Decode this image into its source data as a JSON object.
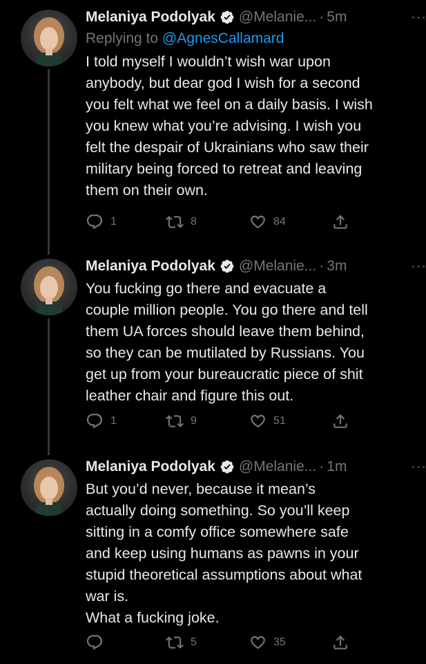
{
  "colors": {
    "background": "#000000",
    "text": "#e7e9ea",
    "muted": "#71767b",
    "link": "#1d9bf0",
    "verified": "#e7e9ea"
  },
  "tweets": [
    {
      "name": "Melaniya Podolyak",
      "handle": "@Melanie...",
      "time": "5m",
      "replying_prefix": "Replying to ",
      "replying_to": "@AgnesCallamard",
      "text": "I told myself I wouldn’t wish war upon\nanybody, but dear god I wish for a second\nyou felt what we feel on a daily basis. I wish\nyou knew what you’re advising. I wish you\nfelt the despair of Ukrainians who saw their\nmilitary being forced to retreat and leaving\nthem on their own.",
      "replies": "1",
      "retweets": "8",
      "likes": "84",
      "icons": [
        "reply-icon",
        "retweet-icon",
        "like-icon",
        "share-icon"
      ]
    },
    {
      "name": "Melaniya Podolyak",
      "handle": "@Melanie...",
      "time": "3m",
      "text": "You fucking go there and evacuate a\ncouple million people. You go there and tell\nthem UA forces should leave them behind,\nso they can be mutilated by Russians. You\nget up from your bureaucratic piece of shit\nleather chair and figure this out.",
      "replies": "1",
      "retweets": "9",
      "likes": "51",
      "icons": [
        "reply-icon",
        "retweet-icon",
        "like-icon",
        "share-icon"
      ]
    },
    {
      "name": "Melaniya Podolyak",
      "handle": "@Melanie...",
      "time": "1m",
      "text": "But you’d never, because it mean’s\nactually doing something. So you’ll keep\nsitting in a comfy office somewhere safe\nand keep using humans as pawns in your\nstupid theoretical assumptions about what\nwar is.\nWhat a fucking joke.",
      "replies": "",
      "retweets": "5",
      "likes": "35",
      "icons": [
        "reply-icon",
        "retweet-icon",
        "like-icon",
        "share-icon"
      ]
    }
  ],
  "separator": "·",
  "more_label": "···"
}
